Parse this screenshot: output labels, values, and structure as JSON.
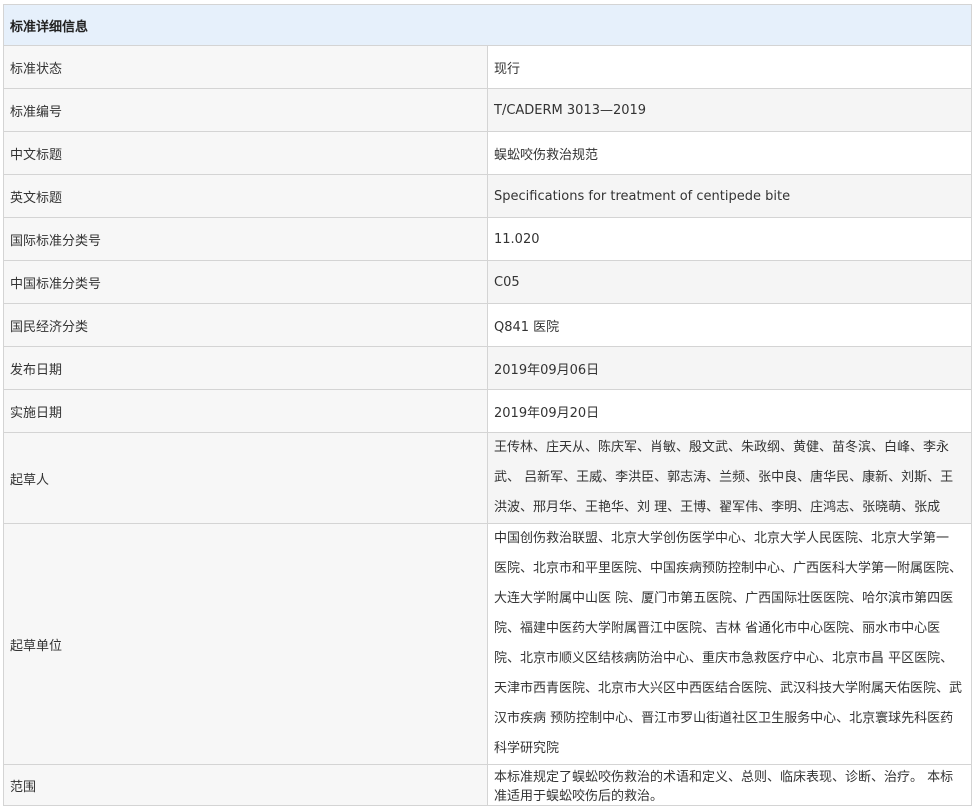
{
  "table": {
    "header": "标准详细信息",
    "rows": [
      {
        "label": "标准状态",
        "value": "现行"
      },
      {
        "label": "标准编号",
        "value": "T/CADERM 3013—2019"
      },
      {
        "label": "中文标题",
        "value": "蜈蚣咬伤救治规范"
      },
      {
        "label": "英文标题",
        "value": "Specifications for treatment of centipede bite"
      },
      {
        "label": "国际标准分类号",
        "value": "11.020"
      },
      {
        "label": "中国标准分类号",
        "value": "C05"
      },
      {
        "label": "国民经济分类",
        "value": "Q841 医院"
      },
      {
        "label": "发布日期",
        "value": "2019年09月06日"
      },
      {
        "label": "实施日期",
        "value": "2019年09月20日"
      },
      {
        "label": "起草人",
        "value": "王传林、庄天从、陈庆军、肖敏、殷文武、朱政纲、黄健、苗冬滨、白峰、李永武、 吕新军、王威、李洪臣、郭志涛、兰频、张中良、唐华民、康新、刘斯、王洪波、邢月华、王艳华、刘 理、王博、翟军伟、李明、庄鸿志、张晓萌、张成"
      },
      {
        "label": "起草单位",
        "value": "中国创伤救治联盟、北京大学创伤医学中心、北京大学人民医院、北京大学第一 医院、北京市和平里医院、中国疾病预防控制中心、广西医科大学第一附属医院、大连大学附属中山医 院、厦门市第五医院、广西国际壮医医院、哈尔滨市第四医院、福建中医药大学附属晋江中医院、吉林 省通化市中心医院、丽水市中心医院、北京市顺义区结核病防治中心、重庆市急救医疗中心、北京市昌 平区医院、天津市西青医院、北京市大兴区中西医结合医院、武汉科技大学附属天佑医院、武汉市疾病 预防控制中心、晋江市罗山街道社区卫生服务中心、北京寰球先科医药科学研究院"
      },
      {
        "label": "范围",
        "value": "本标准规定了蜈蚣咬伤救治的术语和定义、总则、临床表现、诊断、治疗。 本标准适用于蜈蚣咬伤后的救治。"
      }
    ]
  }
}
